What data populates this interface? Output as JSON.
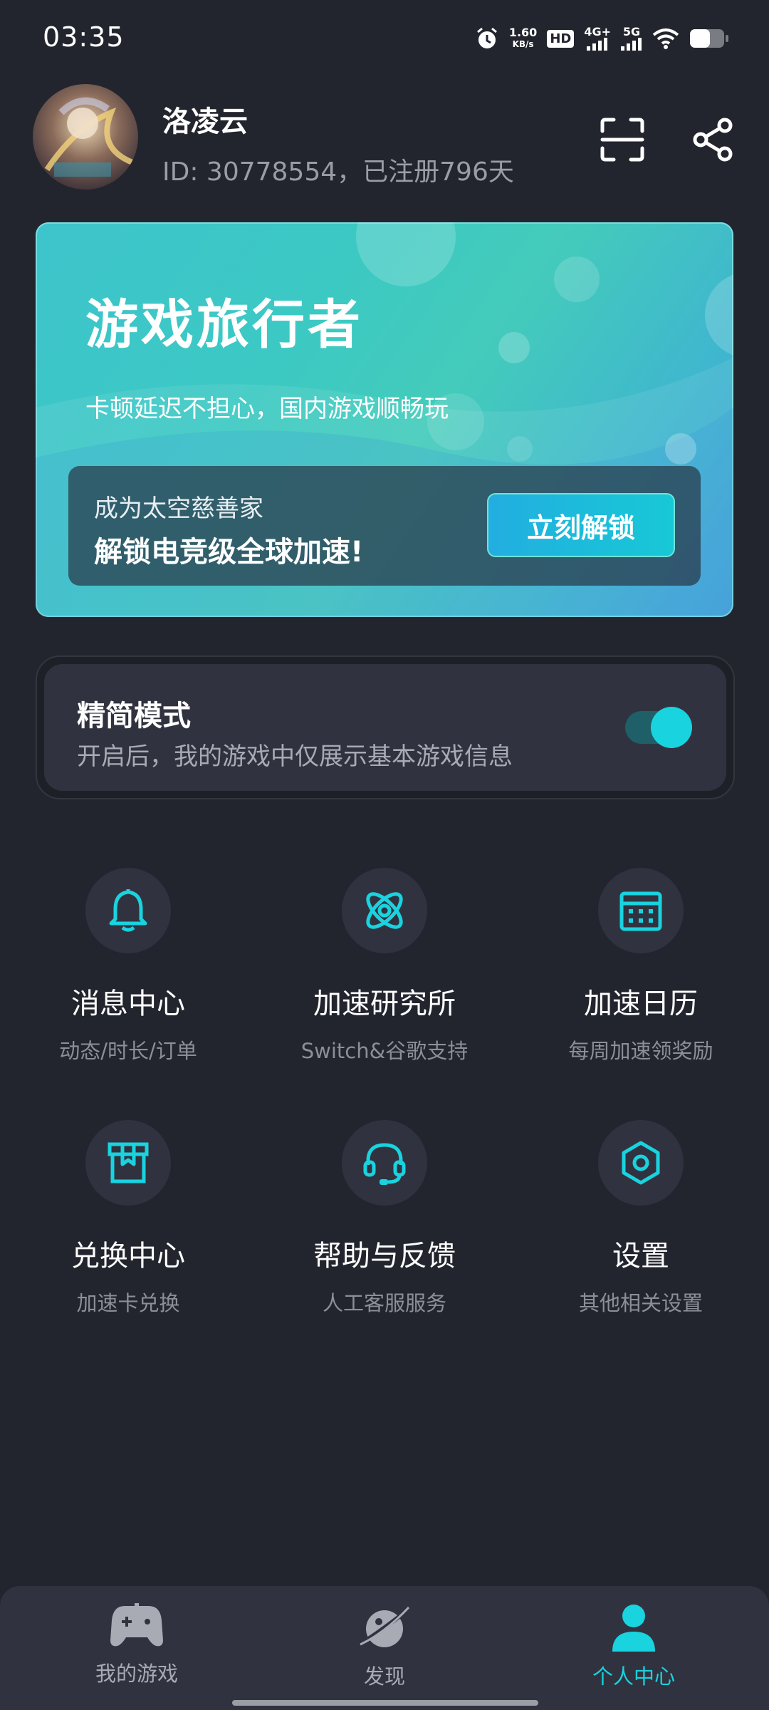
{
  "status_bar": {
    "time": "03:35",
    "net_speed_value": "1.60",
    "net_speed_unit": "KB/s",
    "hd_label": "HD",
    "sim_4g": "4G+",
    "sim_5g": "5G"
  },
  "profile": {
    "name": "洛凌云",
    "id_line": "ID: 30778554，已注册796天"
  },
  "vip_card": {
    "title": "游戏旅行者",
    "description": "卡顿延迟不担心，国内游戏顺畅玩",
    "promo_line1": "成为太空慈善家",
    "promo_line2": "解锁电竞级全球加速!",
    "unlock_label": "立刻解锁"
  },
  "simple_mode": {
    "title": "精简模式",
    "description": "开启后，我的游戏中仅展示基本游戏信息",
    "enabled": true
  },
  "menu": {
    "items": [
      {
        "title": "消息中心",
        "subtitle": "动态/时长/订单",
        "icon": "bell-icon"
      },
      {
        "title": "加速研究所",
        "subtitle": "Switch&谷歌支持",
        "icon": "atom-icon"
      },
      {
        "title": "加速日历",
        "subtitle": "每周加速领奖励",
        "icon": "calendar-icon"
      },
      {
        "title": "兑换中心",
        "subtitle": "加速卡兑换",
        "icon": "gift-box-icon"
      },
      {
        "title": "帮助与反馈",
        "subtitle": "人工客服服务",
        "icon": "headset-icon"
      },
      {
        "title": "设置",
        "subtitle": "其他相关设置",
        "icon": "settings-hex-icon"
      }
    ]
  },
  "bottom_nav": {
    "items": [
      {
        "label": "我的游戏",
        "icon": "gamepad-icon",
        "active": false
      },
      {
        "label": "发现",
        "icon": "planet-icon",
        "active": false
      },
      {
        "label": "个人中心",
        "icon": "person-icon",
        "active": true
      }
    ]
  },
  "colors": {
    "background": "#23252e",
    "card": "#30333f",
    "accent": "#19d3df",
    "muted_text": "#8c8e98",
    "nav_inactive": "#a8aab4"
  }
}
